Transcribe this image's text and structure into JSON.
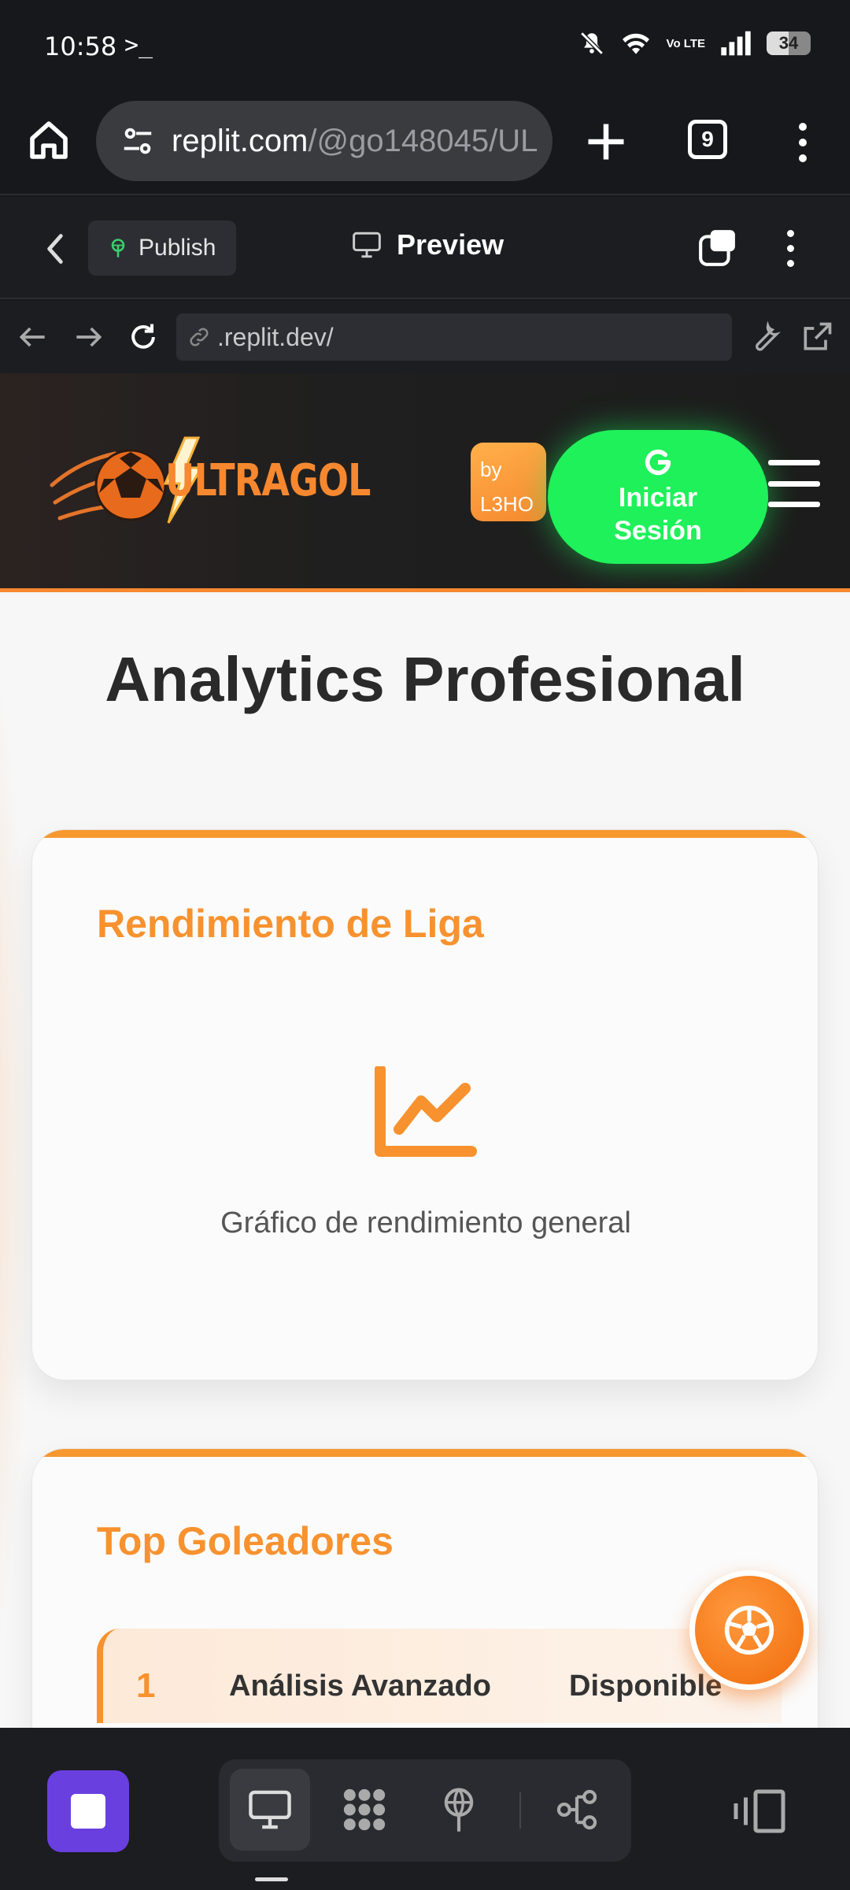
{
  "status_bar": {
    "time": "10:58",
    "terminal_glyph": ">_",
    "volte": "Vo LTE",
    "battery": "34"
  },
  "browser": {
    "url_host": "replit.com",
    "url_path": "/@go148045/UL",
    "tab_count": "9"
  },
  "replit_toolbar": {
    "publish_label": "Publish",
    "preview_label": "Preview"
  },
  "webview_nav": {
    "address": ".replit.dev/"
  },
  "site": {
    "logo_text": "ULTRAGOL",
    "by_badge_line1": "by",
    "by_badge_line2": "L3HO",
    "login_line1": "Iniciar",
    "login_line2": "Sesión",
    "page_title": "Analytics Profesional",
    "accent_color": "#f7882f",
    "login_color": "#1ef15a"
  },
  "cards": {
    "performance": {
      "title": "Rendimiento de Liga",
      "icon": "line-chart-icon",
      "caption": "Gráfico de rendimiento general"
    },
    "scorers": {
      "title": "Top Goleadores",
      "rows": [
        {
          "rank": "1",
          "name": "Análisis Avanzado",
          "status": "Disponible"
        }
      ]
    }
  },
  "bottom_bar": {
    "stop_color": "#6a3fe0",
    "segments": [
      "preview-icon",
      "workspace-icon",
      "publish-icon",
      "git-icon"
    ]
  }
}
